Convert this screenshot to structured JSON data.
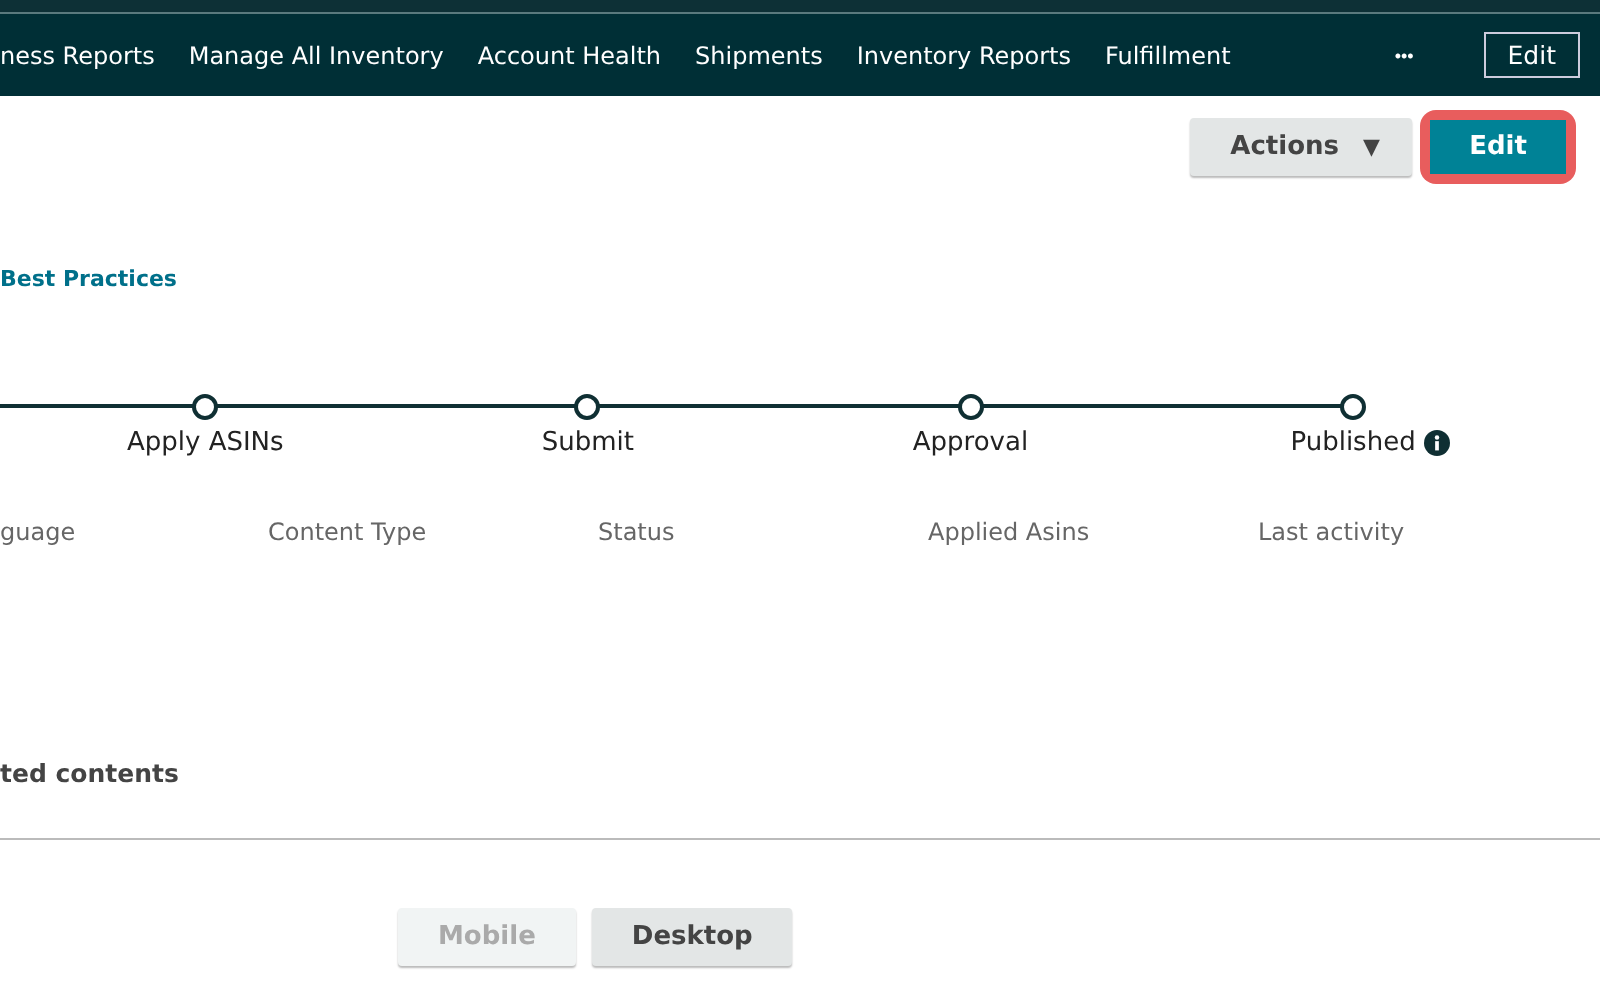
{
  "nav": {
    "items": [
      {
        "label": "ness Reports"
      },
      {
        "label": "Manage All Inventory"
      },
      {
        "label": "Account Health"
      },
      {
        "label": "Shipments"
      },
      {
        "label": "Inventory Reports"
      },
      {
        "label": "Fulfillment"
      }
    ],
    "more": "•••",
    "edit": "Edit"
  },
  "toolbar": {
    "actions": "Actions",
    "actions_caret": "▼",
    "edit": "Edit"
  },
  "link": "Best Practices",
  "steps": [
    {
      "label": "Apply ASINs",
      "info": false
    },
    {
      "label": "Submit",
      "info": false
    },
    {
      "label": "Approval",
      "info": false
    },
    {
      "label": "Published",
      "info": true
    }
  ],
  "columns": [
    "guage",
    "Content Type",
    "Status",
    "Applied Asins",
    "Last activity"
  ],
  "section_title": "ted contents",
  "view_buttons": [
    {
      "label": "Mobile",
      "disabled": true
    },
    {
      "label": "Desktop",
      "disabled": false
    }
  ]
}
